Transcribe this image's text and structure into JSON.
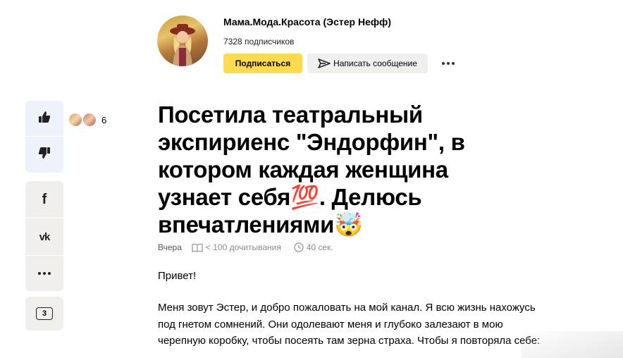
{
  "channel": {
    "name": "Мама.Мода.Красота (Эстер Нефф)",
    "subscribers": "7328 подписчиков",
    "subscribe_label": "Подписаться",
    "message_label": "Написать сообщение"
  },
  "sidebar": {
    "like_count": "6",
    "share_facebook": "f",
    "share_vk": "vk",
    "comments_count": "3"
  },
  "article": {
    "title": "Посетила театральный экспириенс \"Эндорфин\", в котором каждая женщина узнает себя💯. Делюсь впечатлениями🤯",
    "date": "Вчера",
    "reads": "< 100 дочитывания",
    "read_time": "40 сек.",
    "greeting": "Привет!",
    "body": "Меня зовут Эстер, и добро пожаловать на мой канал. Я всю жизнь нахожусь под гнетом сомнений. Они одолевают меня и глубоко залезают в мою черепную коробку, чтобы посеять там зерна страха. Чтобы я повторяла себе:"
  },
  "colors": {
    "accent": "#ffdb4d",
    "like_panel_bg": "#eef3fb",
    "panel_bg": "#f0efec"
  }
}
